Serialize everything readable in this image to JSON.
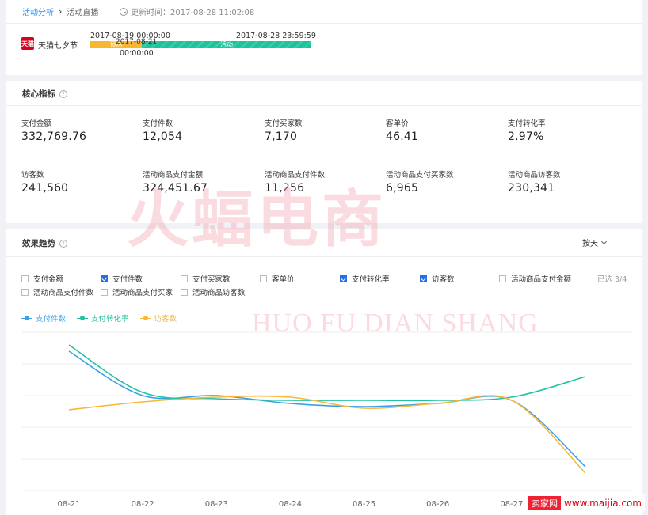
{
  "breadcrumb": {
    "root": "活动分析",
    "current": "活动直播"
  },
  "update_time": "更新时间：2017-08-28 11:02:08",
  "event": {
    "logo_text": "天猫",
    "name": "天猫七夕节",
    "start": "2017-08-19 00:00:00",
    "end": "2017-08-28 23:59:59",
    "live_start": "2017-08-21",
    "live_start_time": "00:00:00",
    "phase_pre": "预热",
    "phase_live": "活动"
  },
  "metrics": {
    "title": "核心指标",
    "items": [
      {
        "label": "支付金额",
        "value": "332,769.76"
      },
      {
        "label": "支付件数",
        "value": "12,054"
      },
      {
        "label": "支付买家数",
        "value": "7,170"
      },
      {
        "label": "客单价",
        "value": "46.41"
      },
      {
        "label": "支付转化率",
        "value": "2.97%"
      },
      {
        "label": "访客数",
        "value": "241,560"
      },
      {
        "label": "活动商品支付金额",
        "value": "324,451.67"
      },
      {
        "label": "活动商品支付件数",
        "value": "11,256"
      },
      {
        "label": "活动商品支付买家数",
        "value": "6,965"
      },
      {
        "label": "活动商品访客数",
        "value": "230,341"
      }
    ]
  },
  "trend": {
    "title": "效果趋势",
    "period": "按天",
    "selected_count": "已选 3/4",
    "checkboxes": [
      {
        "label": "支付金额",
        "checked": false
      },
      {
        "label": "支付件数",
        "checked": true
      },
      {
        "label": "支付买家数",
        "checked": false
      },
      {
        "label": "客单价",
        "checked": false
      },
      {
        "label": "支付转化率",
        "checked": true
      },
      {
        "label": "访客数",
        "checked": true
      },
      {
        "label": "活动商品支付金额",
        "checked": false
      },
      {
        "label": "活动商品支付件数",
        "checked": false
      },
      {
        "label": "活动商品支付买家",
        "checked": false
      },
      {
        "label": "活动商品访客数",
        "checked": false
      }
    ]
  },
  "chart_data": {
    "type": "line",
    "x": [
      "08-21",
      "08-22",
      "08-23",
      "08-24",
      "08-25",
      "08-26",
      "08-27",
      "08-28"
    ],
    "grid": true,
    "legend_position": "top-left",
    "series": [
      {
        "name": "支付件数",
        "color": "#3aa0e6",
        "values": [
          0.88,
          0.6,
          0.6,
          0.55,
          0.53,
          0.55,
          0.57,
          0.15
        ]
      },
      {
        "name": "支付转化率",
        "color": "#20c3a0",
        "values": [
          0.92,
          0.62,
          0.58,
          0.57,
          0.57,
          0.57,
          0.59,
          0.72
        ]
      },
      {
        "name": "访客数",
        "color": "#f9b73a",
        "values": [
          0.51,
          0.56,
          0.59,
          0.59,
          0.52,
          0.55,
          0.57,
          0.11
        ]
      }
    ],
    "ylim": [
      0,
      1
    ]
  },
  "watermark": {
    "title": "火蝠电商",
    "subtitle": "HUO FU DIAN SHANG"
  },
  "site_badge": {
    "logo": "卖家网",
    "url": "www.maijia.com"
  }
}
